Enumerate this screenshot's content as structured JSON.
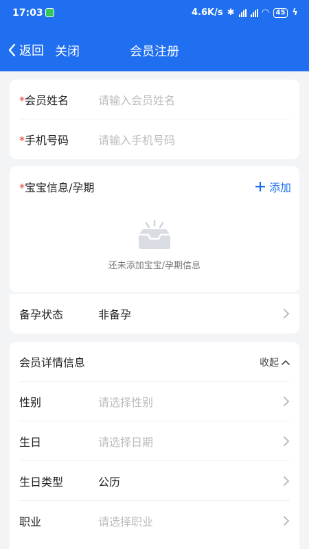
{
  "status_bar": {
    "time": "17:03",
    "network_speed": "4.6K/s",
    "battery": "45"
  },
  "nav": {
    "back_label": "返回",
    "close_label": "关闭",
    "title": "会员注册"
  },
  "basic": {
    "name": {
      "required_mark": "*",
      "label": "会员姓名",
      "placeholder": "请输入会员姓名"
    },
    "phone": {
      "required_mark": "*",
      "label": "手机号码",
      "placeholder": "请输入手机号码"
    }
  },
  "baby": {
    "required_mark": "*",
    "label": "宝宝信息/孕期",
    "add_label": "添加",
    "empty_text": "还未添加宝宝/孕期信息"
  },
  "pregnancy": {
    "label": "备孕状态",
    "value": "非备孕"
  },
  "details": {
    "title": "会员详情信息",
    "collapse_label": "收起",
    "rows": [
      {
        "label": "性别",
        "placeholder": "请选择性别"
      },
      {
        "label": "生日",
        "placeholder": "请选择日期"
      },
      {
        "label": "生日类型",
        "value": "公历"
      },
      {
        "label": "职业",
        "placeholder": "请选择职业"
      }
    ]
  },
  "colors": {
    "primary": "#1f6ff0",
    "required": "#e53935",
    "placeholder": "#bdbdbd"
  }
}
